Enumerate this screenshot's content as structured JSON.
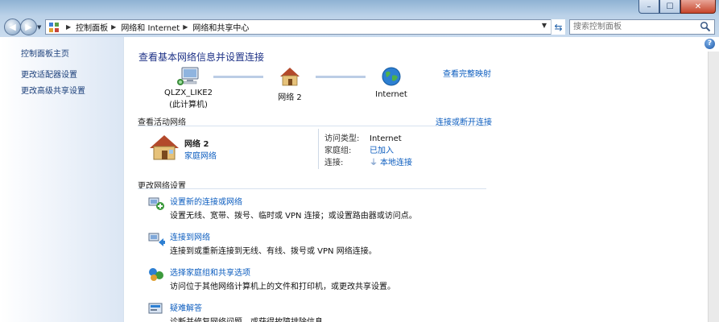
{
  "window": {
    "controls": {
      "minimize": "–",
      "maximize": "☐",
      "close": "✕"
    }
  },
  "address": {
    "breadcrumbs": [
      "控制面板",
      "网络和 Internet",
      "网络和共享中心"
    ],
    "search_placeholder": "搜索控制面板"
  },
  "sidebar": {
    "items": [
      {
        "label": "控制面板主页"
      },
      {
        "label": "更改适配器设置"
      },
      {
        "label": "更改高级共享设置"
      }
    ]
  },
  "main": {
    "title": "查看基本网络信息并设置连接",
    "view_full_map": "查看完整映射",
    "map": {
      "computer_name": "QLZX_LIKE2",
      "computer_sub": "(此计算机)",
      "network_name": "网络  2",
      "internet": "Internet"
    },
    "active_networks": {
      "heading": "查看活动网络",
      "connect_link": "连接或断开连接",
      "network_name": "网络  2",
      "network_type": "家庭网络",
      "access_type_label": "访问类型:",
      "access_type_value": "Internet",
      "homegroup_label": "家庭组:",
      "homegroup_value": "已加入",
      "connection_label": "连接:",
      "connection_value": "本地连接"
    },
    "change_settings": {
      "heading": "更改网络设置",
      "tasks": [
        {
          "link": "设置新的连接或网络",
          "desc": "设置无线、宽带、拨号、临时或 VPN 连接；或设置路由器或访问点。",
          "icon": "new-connection-icon"
        },
        {
          "link": "连接到网络",
          "desc": "连接到或重新连接到无线、有线、拨号或 VPN 网络连接。",
          "icon": "connect-network-icon"
        },
        {
          "link": "选择家庭组和共享选项",
          "desc": "访问位于其他网络计算机上的文件和打印机，或更改共享设置。",
          "icon": "homegroup-icon"
        },
        {
          "link": "疑难解答",
          "desc": "诊断并修复网络问题，或获得故障排除信息。",
          "icon": "troubleshoot-icon"
        }
      ]
    }
  },
  "colors": {
    "link": "#0b5cbf",
    "title": "#1e3287",
    "sidebar_link": "#1b3f7a"
  }
}
